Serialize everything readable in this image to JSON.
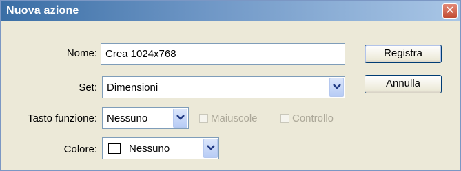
{
  "window": {
    "title": "Nuova azione",
    "close_glyph": "✕"
  },
  "form": {
    "name_label": "Nome:",
    "name_value": "Crea 1024x768",
    "set_label": "Set:",
    "set_value": "Dimensioni",
    "function_key_label": "Tasto funzione:",
    "function_key_value": "Nessuno",
    "shift_label": "Maiuscole",
    "shift_checked": false,
    "control_label": "Controllo",
    "control_checked": false,
    "color_label": "Colore:",
    "color_value": "Nessuno"
  },
  "buttons": {
    "record": "Registra",
    "cancel": "Annulla"
  },
  "colors": {
    "titlebar_start": "#3a6ea5",
    "close_button": "#c14b33",
    "dialog_bg": "#ece9d8"
  }
}
